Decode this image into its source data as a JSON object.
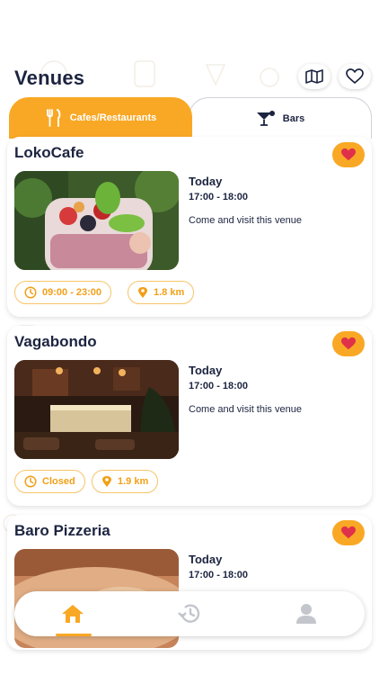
{
  "header": {
    "title": "Venues",
    "map_icon": "map-icon",
    "favorites_icon": "heart-outline-icon"
  },
  "tabs": [
    {
      "label": "Cafes/Restaurants",
      "icon": "fork-knife-icon",
      "active": true
    },
    {
      "label": "Bars",
      "icon": "cocktail-icon",
      "active": false
    }
  ],
  "venues": [
    {
      "name": "LokoCafe",
      "day": "Today",
      "event_time": "17:00 - 18:00",
      "description": "Come and visit this venue",
      "hours": "09:00 - 23:00",
      "distance": "1.8 km",
      "favorite": true
    },
    {
      "name": "Vagabondo",
      "day": "Today",
      "event_time": "17:00 - 18:00",
      "description": "Come and visit this venue",
      "hours": "Closed",
      "distance": "1.9 km",
      "favorite": true
    },
    {
      "name": "Baro Pizzeria",
      "day": "Today",
      "event_time": "17:00 - 18:00",
      "description": "",
      "hours": "",
      "distance": "",
      "favorite": true
    }
  ],
  "bottom_nav": [
    {
      "icon": "home-icon",
      "active": true
    },
    {
      "icon": "history-icon",
      "active": false
    },
    {
      "icon": "profile-icon",
      "active": false
    }
  ],
  "colors": {
    "accent": "#f9a825",
    "text": "#1c2440",
    "favorite_heart": "#e0314a"
  }
}
